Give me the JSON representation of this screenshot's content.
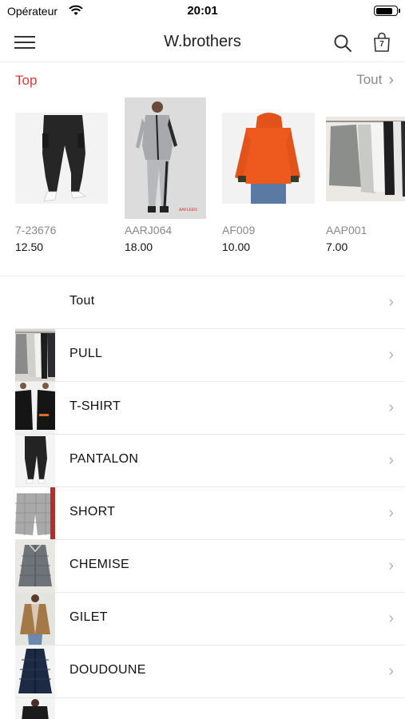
{
  "status_bar": {
    "carrier": "Opérateur",
    "time": "20:01",
    "battery_level": 0.85
  },
  "nav": {
    "title": "W.brothers",
    "cart_count": "7"
  },
  "top": {
    "title": "Top",
    "see_all": "Tout",
    "products": [
      {
        "code": "7-23676",
        "price": "12.50"
      },
      {
        "code": "AARJ064",
        "price": "18.00",
        "tag": "AAFLEEN"
      },
      {
        "code": "AF009",
        "price": "10.00"
      },
      {
        "code": "AAP001",
        "price": "7.00"
      }
    ]
  },
  "categories": [
    {
      "label": "Tout"
    },
    {
      "label": "PULL"
    },
    {
      "label": "T-SHIRT"
    },
    {
      "label": "PANTALON"
    },
    {
      "label": "SHORT"
    },
    {
      "label": "CHEMISE"
    },
    {
      "label": "GILET"
    },
    {
      "label": "DOUDOUNE"
    },
    {
      "label": ""
    }
  ],
  "colors": {
    "accent": "#e03a3a",
    "muted": "#888888",
    "divider": "#e6e6e6"
  }
}
